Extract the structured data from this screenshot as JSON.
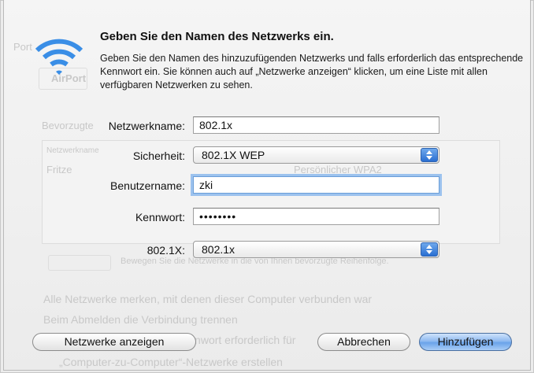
{
  "dialog": {
    "title": "Geben Sie den Namen des Netzwerks ein.",
    "description": "Geben Sie den Namen des hinzuzufügenden Netzwerks und falls erforderlich das entsprechende Kennwort ein. Sie können auch auf „Netzwerke anzeigen“ klicken, um eine Liste mit allen verfügbaren Netzwerken zu sehen.",
    "icon": "wifi-icon"
  },
  "form": {
    "network_name": {
      "label": "Netzwerkname:",
      "value": "802.1x"
    },
    "security": {
      "label": "Sicherheit:",
      "value": "802.1X WEP"
    },
    "username": {
      "label": "Benutzername:",
      "value": "zki"
    },
    "password": {
      "label": "Kennwort:",
      "value": "••••••••"
    },
    "eap": {
      "label": "802.1X:",
      "value": "802.1x"
    }
  },
  "buttons": {
    "show_networks": "Netzwerke anzeigen",
    "cancel": "Abbrechen",
    "add": "Hinzufügen"
  },
  "background": {
    "port_label": "Port",
    "airport_tab": "AirPort",
    "preferred_label": "Bevorzugte",
    "network_col": "Netzwerkname",
    "network_row": "Fritze",
    "security_col": "Persönlicher WPA2",
    "reorder_hint": "Bewegen Sie die Netzwerke in die von Ihnen bevorzugte Reihenfolge.",
    "opt1": "Alle Netzwerke merken, mit denen dieser Computer verbunden war",
    "opt2": "Beim Abmelden die Verbindung trennen",
    "opt3": "Administrator-Kennwort erforderlich für",
    "opt4": "„Computer-zu-Computer“-Netzwerke erstellen"
  },
  "colors": {
    "accent": "#6aa3ea",
    "focus_ring": "#9cc2ee",
    "wifi": "#3a8ee6"
  }
}
